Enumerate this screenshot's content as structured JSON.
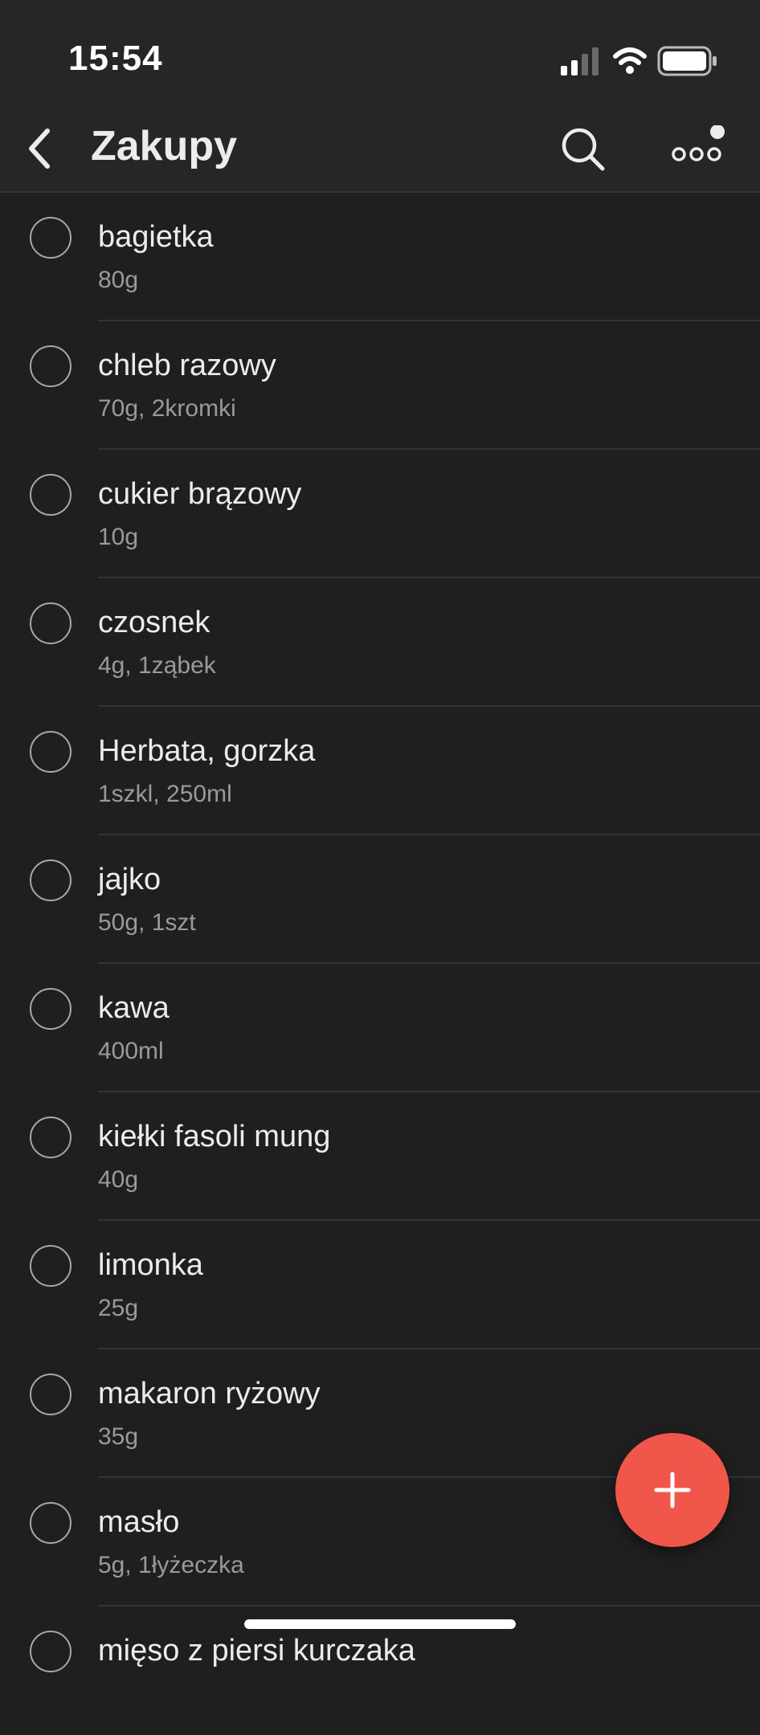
{
  "status_bar": {
    "time": "15:54"
  },
  "header": {
    "title": "Zakupy"
  },
  "icons": {
    "back": "chevron-left-icon",
    "search": "search-icon",
    "more": "ellipsis-icon",
    "add": "plus-icon"
  },
  "colors": {
    "background": "#1f1f1f",
    "header": "#262626",
    "fab": "#f0564a",
    "primary_text": "#ececec",
    "secondary_text": "#9a9a9a"
  },
  "items": [
    {
      "name": "bagietka",
      "qty": "80g"
    },
    {
      "name": "chleb razowy",
      "qty": "70g, 2kromki"
    },
    {
      "name": "cukier brązowy",
      "qty": "10g"
    },
    {
      "name": "czosnek",
      "qty": "4g, 1ząbek"
    },
    {
      "name": "Herbata, gorzka",
      "qty": "1szkl, 250ml"
    },
    {
      "name": "jajko",
      "qty": "50g, 1szt"
    },
    {
      "name": "kawa",
      "qty": "400ml"
    },
    {
      "name": "kiełki fasoli mung",
      "qty": "40g"
    },
    {
      "name": "limonka",
      "qty": "25g"
    },
    {
      "name": "makaron ryżowy",
      "qty": "35g"
    },
    {
      "name": "masło",
      "qty": "5g, 1łyżeczka"
    },
    {
      "name": "mięso z piersi kurczaka",
      "qty": ""
    }
  ]
}
